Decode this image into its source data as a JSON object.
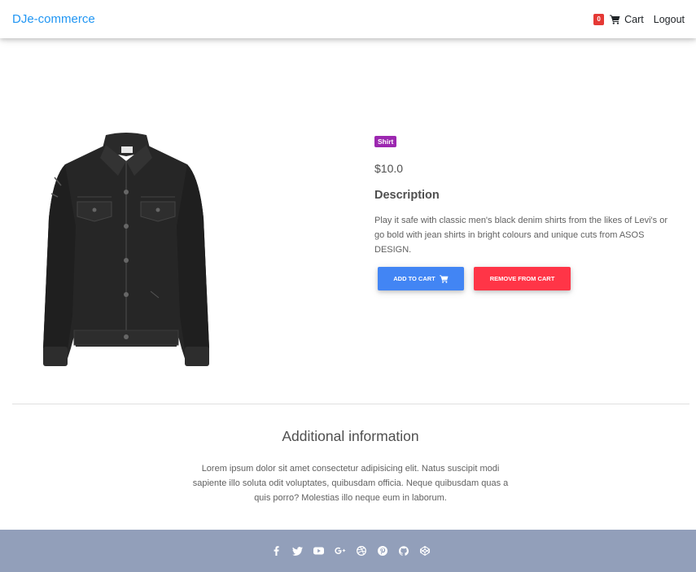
{
  "navbar": {
    "brand": "DJe-commerce",
    "cart_count": "0",
    "cart_label": "Cart",
    "logout_label": "Logout"
  },
  "product": {
    "category": "Shirt",
    "price": "$10.0",
    "description_heading": "Description",
    "description": "Play it safe with classic men's black denim shirts from the likes of Levi's or go bold with jean shirts in bright colours and unique cuts from ASOS DESIGN.",
    "add_to_cart_label": "ADD TO CART",
    "remove_from_cart_label": "REMOVE FROM CART"
  },
  "additional": {
    "heading": "Additional information",
    "text": "Lorem ipsum dolor sit amet consectetur adipisicing elit. Natus suscipit modi sapiente illo soluta odit voluptates, quibusdam officia. Neque quibusdam quas a quis porro? Molestias illo neque eum in laborum."
  },
  "footer": {
    "social_icons": [
      "facebook-icon",
      "twitter-icon",
      "youtube-icon",
      "google-plus-icon",
      "dribbble-icon",
      "pinterest-icon",
      "github-icon",
      "codepen-icon"
    ]
  },
  "colors": {
    "brand": "#2196f3",
    "badge": "#9c27b0",
    "add_button": "#4285f4",
    "remove_button": "#ff3547",
    "footer": "#929fba",
    "cart_badge": "#e53935"
  }
}
